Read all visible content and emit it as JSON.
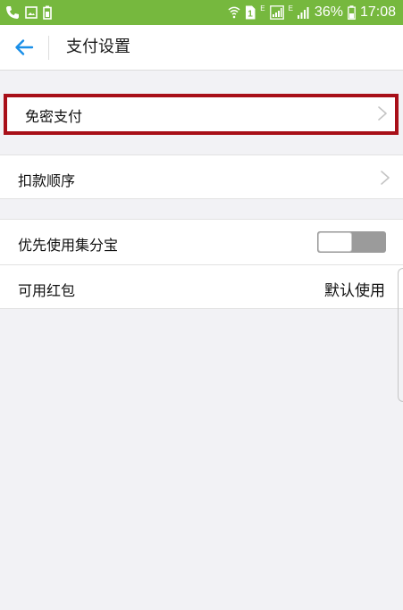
{
  "status_bar": {
    "left_icons": [
      "phone-icon",
      "image-icon",
      "battery-save-icon"
    ],
    "right_icons": [
      "wifi-icon",
      "sim-1-icon",
      "signal-icon",
      "signal-icon"
    ],
    "network_type_1": "E",
    "network_type_2": "E",
    "battery_percent": "36%",
    "time": "17:08"
  },
  "header": {
    "back_icon": "back-arrow-icon",
    "title": "支付设置"
  },
  "settings": {
    "password_free_pay": {
      "label": "免密支付",
      "icon": "chevron-right-icon",
      "highlighted": true
    },
    "deduction_order": {
      "label": "扣款顺序",
      "icon": "chevron-right-icon"
    },
    "prefer_jifenbao": {
      "label": "优先使用集分宝",
      "toggle_state": "off"
    },
    "available_red_packet": {
      "label": "可用红包",
      "value": "默认使用"
    }
  },
  "colors": {
    "status_bar": "#76b83e",
    "accent_blue": "#1a8fe8",
    "highlight_border": "#a80f18",
    "background": "#f2f2f5",
    "toggle_off": "#9b9b9b"
  }
}
